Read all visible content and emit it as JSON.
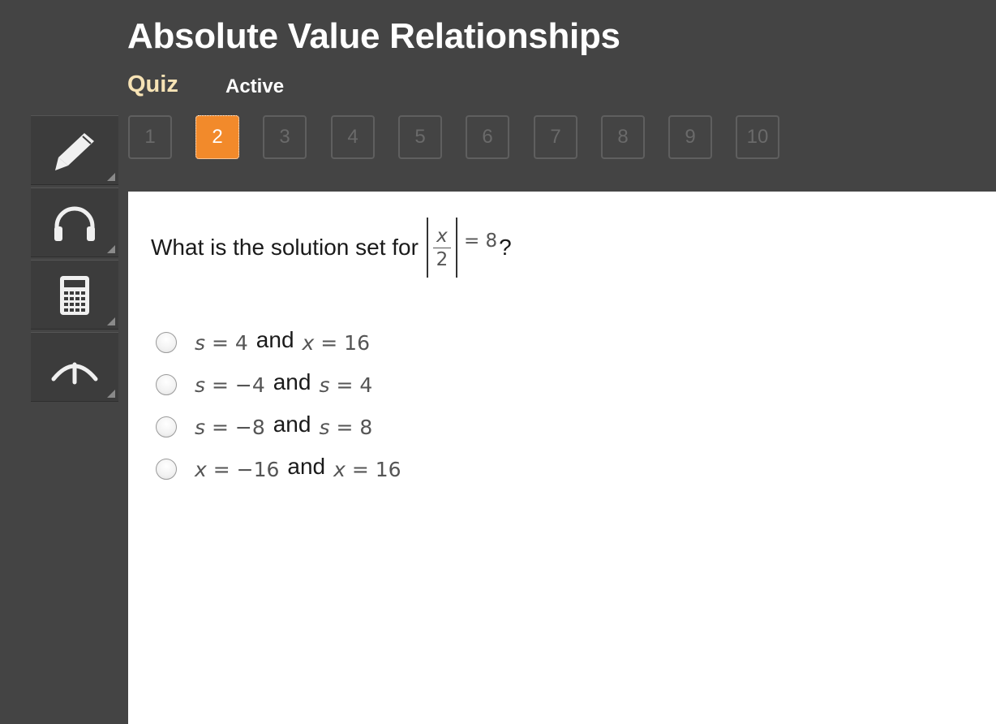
{
  "header": {
    "title": "Absolute Value Relationships",
    "section": "Quiz",
    "status": "Active"
  },
  "question_nav": {
    "items": [
      "1",
      "2",
      "3",
      "4",
      "5",
      "6",
      "7",
      "8",
      "9",
      "10"
    ],
    "current": "2"
  },
  "tools": [
    "pencil-icon",
    "headphones-icon",
    "calculator-icon",
    "reference-icon"
  ],
  "question": {
    "prefix": "What is the solution set for",
    "var": "x",
    "denominator": "2",
    "tail": "= 8",
    "suffix": "?"
  },
  "options": [
    {
      "a_var": "s",
      "a_val": "= 4",
      "conj": "and",
      "b_var": "x",
      "b_val": "= 16"
    },
    {
      "a_var": "s",
      "a_val": "= −4",
      "conj": "and",
      "b_var": "s",
      "b_val": "= 4"
    },
    {
      "a_var": "s",
      "a_val": "= −8",
      "conj": "and",
      "b_var": "s",
      "b_val": "= 8"
    },
    {
      "a_var": "x",
      "a_val": "= −16",
      "conj": "and",
      "b_var": "x",
      "b_val": "= 16"
    }
  ],
  "colors": {
    "background": "#444444",
    "accent": "#f28a2b",
    "section_label": "#f7e3b5",
    "content_bg": "#ffffff"
  }
}
